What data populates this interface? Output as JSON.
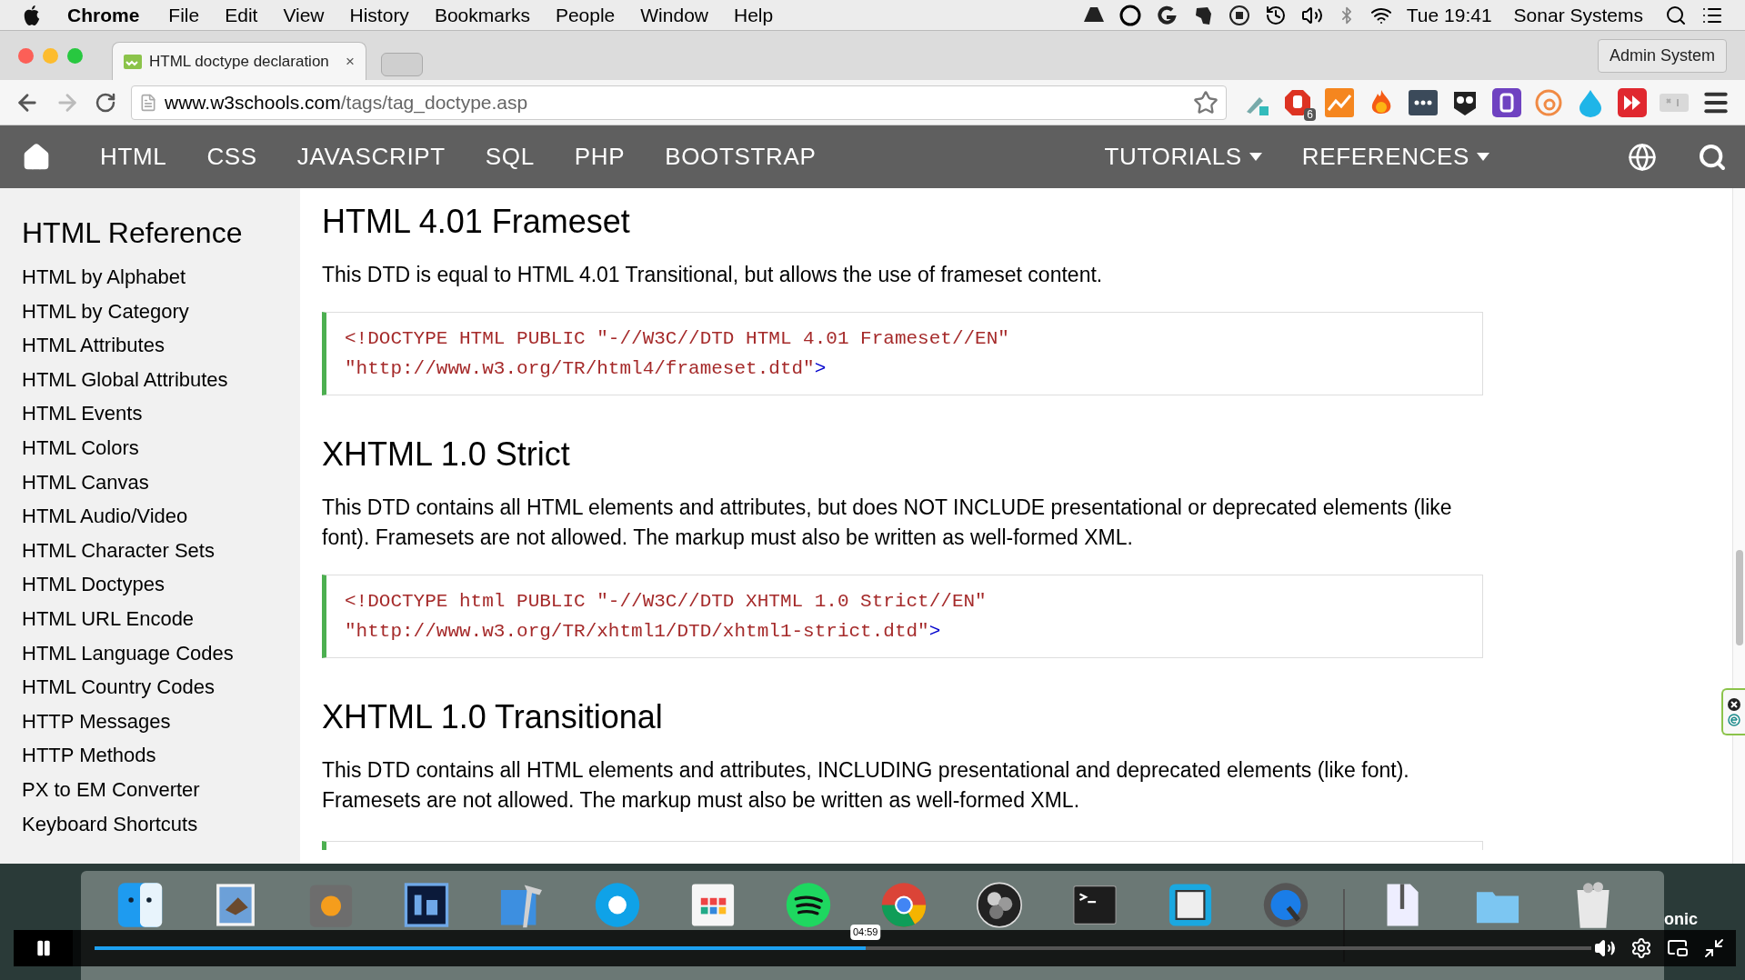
{
  "menu_bar": {
    "app": "Chrome",
    "items": [
      "File",
      "Edit",
      "View",
      "History",
      "Bookmarks",
      "People",
      "Window",
      "Help"
    ],
    "clock": "Tue 19:41",
    "user": "Sonar Systems"
  },
  "browser": {
    "tab": {
      "title": "HTML doctype declaration",
      "close": "×"
    },
    "profile_button": "Admin System",
    "url": {
      "domain": "www.w3schools.com",
      "path": "/tags/tag_doctype.asp"
    },
    "extension_badge": "6"
  },
  "site_nav": {
    "items": [
      {
        "label": "HTML",
        "dropdown": false
      },
      {
        "label": "CSS",
        "dropdown": false
      },
      {
        "label": "JAVASCRIPT",
        "dropdown": false
      },
      {
        "label": "SQL",
        "dropdown": false
      },
      {
        "label": "PHP",
        "dropdown": false
      },
      {
        "label": "BOOTSTRAP",
        "dropdown": false
      }
    ],
    "right_items": [
      {
        "label": "TUTORIALS",
        "dropdown": true
      },
      {
        "label": "REFERENCES",
        "dropdown": true
      }
    ]
  },
  "sidebar": {
    "title": "HTML Reference",
    "items": [
      "HTML by Alphabet",
      "HTML by Category",
      "HTML Attributes",
      "HTML Global Attributes",
      "HTML Events",
      "HTML Colors",
      "HTML Canvas",
      "HTML Audio/Video",
      "HTML Character Sets",
      "HTML Doctypes",
      "HTML URL Encode",
      "HTML Language Codes",
      "HTML Country Codes",
      "HTTP Messages",
      "HTTP Methods",
      "PX to EM Converter",
      "Keyboard Shortcuts"
    ]
  },
  "sections": [
    {
      "heading": "HTML 4.01 Frameset",
      "paragraph": "This DTD is equal to HTML 4.01 Transitional, but allows the use of frameset content.",
      "code": {
        "line_1": "<!DOCTYPE HTML PUBLIC \"-//W3C//DTD HTML 4.01 Frameset//EN\"",
        "line_2": "\"http://www.w3.org/TR/html4/frameset.dtd\"",
        "closing": ">"
      }
    },
    {
      "heading": "XHTML 1.0 Strict",
      "paragraph": "This DTD contains all HTML elements and attributes, but does NOT INCLUDE presentational or deprecated elements (like font). Framesets are not allowed. The markup must also be written as well-formed XML.",
      "code": {
        "line_1": "<!DOCTYPE html PUBLIC \"-//W3C//DTD XHTML 1.0 Strict//EN\"",
        "line_2": "\"http://www.w3.org/TR/xhtml1/DTD/xhtml1-strict.dtd\"",
        "closing": ">"
      }
    },
    {
      "heading": "XHTML 1.0 Transitional",
      "paragraph": "This DTD contains all HTML elements and attributes, INCLUDING presentational and deprecated elements (like font). Framesets are not allowed. The markup must also be written as well-formed XML."
    }
  ],
  "desktop_label": "onic",
  "player": {
    "time": "04:59",
    "level": 0.515,
    "playing": true
  }
}
